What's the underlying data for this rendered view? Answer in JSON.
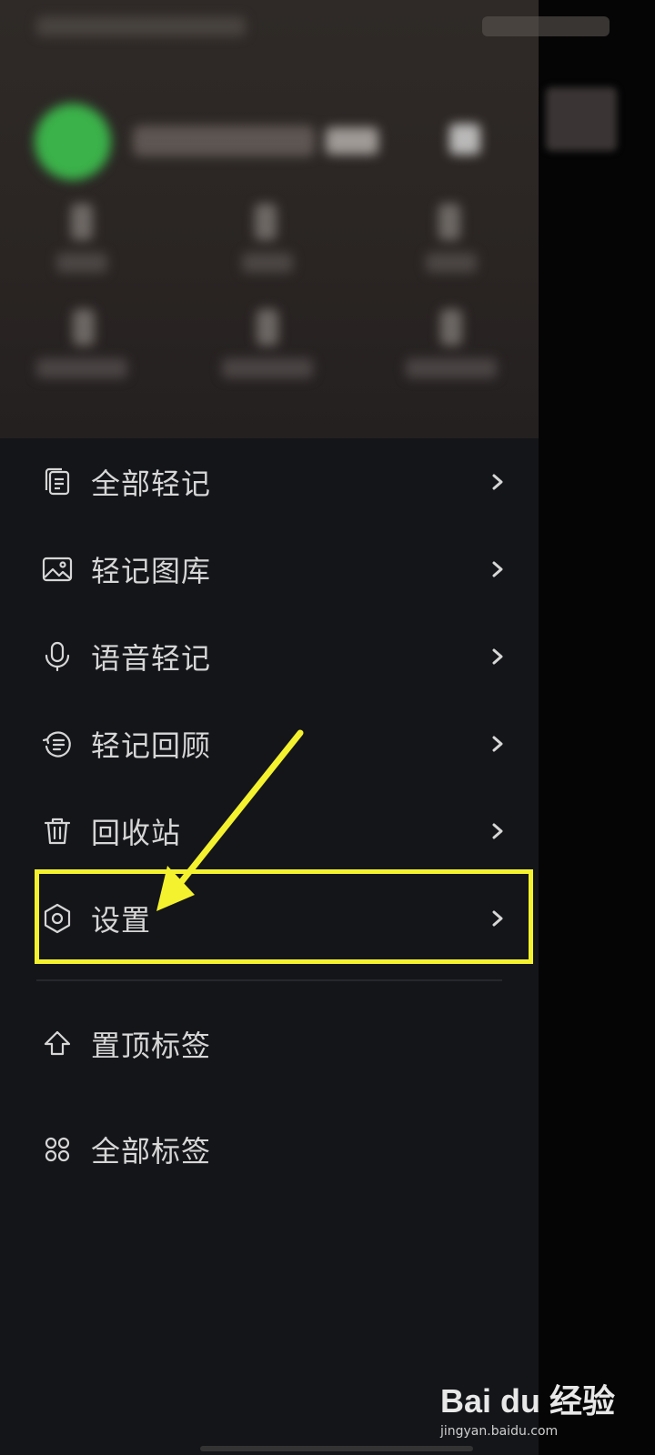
{
  "menu": {
    "items": [
      {
        "label": "全部轻记",
        "icon": "notes-icon"
      },
      {
        "label": "轻记图库",
        "icon": "image-icon"
      },
      {
        "label": "语音轻记",
        "icon": "microphone-icon"
      },
      {
        "label": "轻记回顾",
        "icon": "review-icon"
      },
      {
        "label": "回收站",
        "icon": "trash-icon"
      },
      {
        "label": "设置",
        "icon": "settings-hexagon-icon"
      }
    ]
  },
  "tags": {
    "pinned_label": "置顶标签",
    "all_label": "全部标签"
  },
  "annotation": {
    "highlight_color": "#f4f22e"
  },
  "watermark": {
    "logo": "Bai du 经验",
    "url": "jingyan.baidu.com"
  },
  "colors": {
    "drawer_bg": "#141519",
    "text": "#d6d6d6",
    "avatar_green": "#3bb24a"
  }
}
